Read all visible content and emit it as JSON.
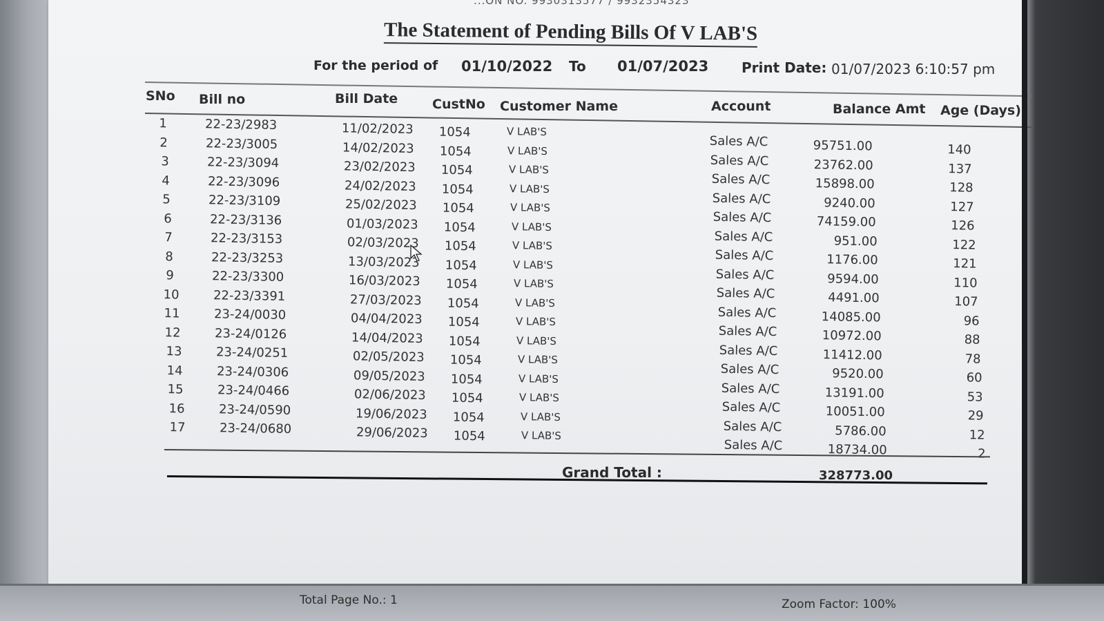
{
  "window": {
    "top_cutoff_text": "...ON NO. 9930313577 / 9932354323"
  },
  "report": {
    "title": "The Statement of Pending Bills Of V LAB'S",
    "period_label": "For the period of",
    "period_from": "01/10/2022",
    "period_to_label": "To",
    "period_to": "01/07/2023",
    "print_date_label": "Print Date:",
    "print_date_value": "01/07/2023   6:10:57 pm"
  },
  "columns": [
    "SNo",
    "Bill no",
    "Bill Date",
    "CustNo",
    "Customer Name",
    "Account",
    "Balance Amt",
    "Age (Days)"
  ],
  "rows": [
    {
      "sno": "1",
      "bill": "22-23/2983",
      "date": "11/02/2023",
      "cust": "1054",
      "name": "V LAB'S",
      "acct": "Sales A/C",
      "bal": "95751.00",
      "age": "140"
    },
    {
      "sno": "2",
      "bill": "22-23/3005",
      "date": "14/02/2023",
      "cust": "1054",
      "name": "V LAB'S",
      "acct": "Sales A/C",
      "bal": "23762.00",
      "age": "137"
    },
    {
      "sno": "3",
      "bill": "22-23/3094",
      "date": "23/02/2023",
      "cust": "1054",
      "name": "V LAB'S",
      "acct": "Sales A/C",
      "bal": "15898.00",
      "age": "128"
    },
    {
      "sno": "4",
      "bill": "22-23/3096",
      "date": "24/02/2023",
      "cust": "1054",
      "name": "V LAB'S",
      "acct": "Sales A/C",
      "bal": "9240.00",
      "age": "127"
    },
    {
      "sno": "5",
      "bill": "22-23/3109",
      "date": "25/02/2023",
      "cust": "1054",
      "name": "V LAB'S",
      "acct": "Sales A/C",
      "bal": "74159.00",
      "age": "126"
    },
    {
      "sno": "6",
      "bill": "22-23/3136",
      "date": "01/03/2023",
      "cust": "1054",
      "name": "V LAB'S",
      "acct": "Sales A/C",
      "bal": "951.00",
      "age": "122"
    },
    {
      "sno": "7",
      "bill": "22-23/3153",
      "date": "02/03/2023",
      "cust": "1054",
      "name": "V LAB'S",
      "acct": "Sales A/C",
      "bal": "1176.00",
      "age": "121"
    },
    {
      "sno": "8",
      "bill": "22-23/3253",
      "date": "13/03/2023",
      "cust": "1054",
      "name": "V LAB'S",
      "acct": "Sales A/C",
      "bal": "9594.00",
      "age": "110"
    },
    {
      "sno": "9",
      "bill": "22-23/3300",
      "date": "16/03/2023",
      "cust": "1054",
      "name": "V LAB'S",
      "acct": "Sales A/C",
      "bal": "4491.00",
      "age": "107"
    },
    {
      "sno": "10",
      "bill": "22-23/3391",
      "date": "27/03/2023",
      "cust": "1054",
      "name": "V LAB'S",
      "acct": "Sales A/C",
      "bal": "14085.00",
      "age": "96"
    },
    {
      "sno": "11",
      "bill": "23-24/0030",
      "date": "04/04/2023",
      "cust": "1054",
      "name": "V LAB'S",
      "acct": "Sales A/C",
      "bal": "10972.00",
      "age": "88"
    },
    {
      "sno": "12",
      "bill": "23-24/0126",
      "date": "14/04/2023",
      "cust": "1054",
      "name": "V LAB'S",
      "acct": "Sales A/C",
      "bal": "11412.00",
      "age": "78"
    },
    {
      "sno": "13",
      "bill": "23-24/0251",
      "date": "02/05/2023",
      "cust": "1054",
      "name": "V LAB'S",
      "acct": "Sales A/C",
      "bal": "9520.00",
      "age": "60"
    },
    {
      "sno": "14",
      "bill": "23-24/0306",
      "date": "09/05/2023",
      "cust": "1054",
      "name": "V LAB'S",
      "acct": "Sales A/C",
      "bal": "13191.00",
      "age": "53"
    },
    {
      "sno": "15",
      "bill": "23-24/0466",
      "date": "02/06/2023",
      "cust": "1054",
      "name": "V LAB'S",
      "acct": "Sales A/C",
      "bal": "10051.00",
      "age": "29"
    },
    {
      "sno": "16",
      "bill": "23-24/0590",
      "date": "19/06/2023",
      "cust": "1054",
      "name": "V LAB'S",
      "acct": "Sales A/C",
      "bal": "5786.00",
      "age": "12"
    },
    {
      "sno": "17",
      "bill": "23-24/0680",
      "date": "29/06/2023",
      "cust": "1054",
      "name": "V LAB'S",
      "acct": "Sales A/C",
      "bal": "18734.00",
      "age": "2"
    }
  ],
  "totals": {
    "label": "Grand Total :",
    "value": "328773.00"
  },
  "status": {
    "pages": "Total Page No.: 1",
    "zoom": "Zoom Factor: 100%"
  },
  "icons": {
    "cursor": "mouse-pointer-icon"
  },
  "colors": {
    "paper": "#f0f1f3",
    "text": "#333333",
    "frame_dark": "#1b1c1f"
  }
}
